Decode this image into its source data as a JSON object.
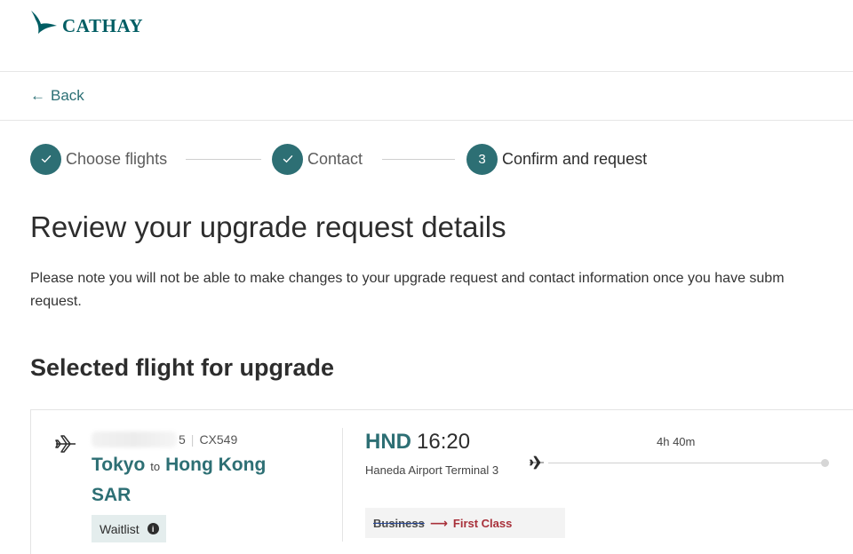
{
  "brand": {
    "name": "CATHAY",
    "color": "#005d63"
  },
  "nav": {
    "back_arrow": "←",
    "back_label": "Back"
  },
  "stepper": {
    "steps": [
      {
        "label": "Choose flights",
        "status": "done",
        "icon": "check-icon"
      },
      {
        "label": "Contact",
        "status": "done",
        "icon": "check-icon"
      },
      {
        "label": "Confirm and request",
        "status": "current",
        "number": "3"
      }
    ]
  },
  "page": {
    "title": "Review your upgrade request details",
    "note_line1": "Please note you will not be able to make changes to your upgrade request and contact information once you have subm",
    "note_line2": "request.",
    "section_title": "Selected flight for upgrade"
  },
  "flight": {
    "meta_partial": "5",
    "flight_number": "CX549",
    "origin": "Tokyo",
    "to_word": "to",
    "destination": "Hong Kong SAR",
    "status": "Waitlist",
    "departure_code": "HND",
    "departure_time": "16:20",
    "departure_airport": "Haneda Airport Terminal 3",
    "duration": "4h 40m",
    "cabin_from": "Business",
    "cabin_arrow": "⟶",
    "cabin_to": "First Class"
  },
  "colors": {
    "teal": "#2d6f74",
    "accent_red": "#a8303a",
    "chip_bg": "#e4eded"
  }
}
